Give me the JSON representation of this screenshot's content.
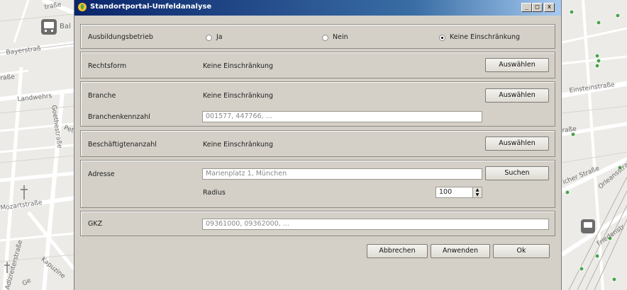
{
  "window": {
    "title": "Standortportal-Umfeldanalyse",
    "controls": {
      "minimize": "_",
      "maximize": "□",
      "close": "x"
    }
  },
  "ausbildungsbetrieb": {
    "label": "Ausbildungsbetrieb",
    "options": [
      "Ja",
      "Nein",
      "Keine Einschränkung"
    ],
    "selected": "Keine Einschränkung"
  },
  "rechtsform": {
    "label": "Rechtsform",
    "value": "Keine Einschränkung",
    "button": "Auswählen"
  },
  "branche": {
    "label": "Branche",
    "value": "Keine Einschränkung",
    "button": "Auswählen",
    "kennzahl_label": "Branchenkennzahl",
    "kennzahl_placeholder": "001577, 447766, ..."
  },
  "beschaeftigte": {
    "label": "Beschäftigtenanzahl",
    "value": "Keine Einschränkung",
    "button": "Auswählen"
  },
  "adresse": {
    "label": "Adresse",
    "placeholder": "Marienplatz 1, München",
    "button": "Suchen",
    "radius_label": "Radius",
    "radius_value": "100",
    "spin_up": "▲",
    "spin_down": "▼"
  },
  "gkz": {
    "label": "GKZ",
    "placeholder": "09361000, 09362000, ..."
  },
  "footer": {
    "cancel": "Abbrechen",
    "apply": "Anwenden",
    "ok": "Ok"
  },
  "map_left": {
    "labels": [
      "traße",
      "Bal",
      "Bayerstraß",
      "raße",
      "Landwehrs",
      "Goethestraße",
      "Pet",
      "Mozartstraße",
      "Adlzreiterstraße",
      "Kapuzine",
      "Ge"
    ]
  },
  "map_right": {
    "labels": [
      "Einsteinstraße",
      "raße",
      "icher Straße",
      "Orleansstraße",
      "Friedenstr"
    ]
  },
  "colors": {
    "accent": "#0a246a",
    "dialog_bg": "#d4d0c8",
    "poi": "#4aa34a"
  },
  "icons": [
    "app-icon",
    "station-icon",
    "church-icon",
    "poi-icon"
  ]
}
